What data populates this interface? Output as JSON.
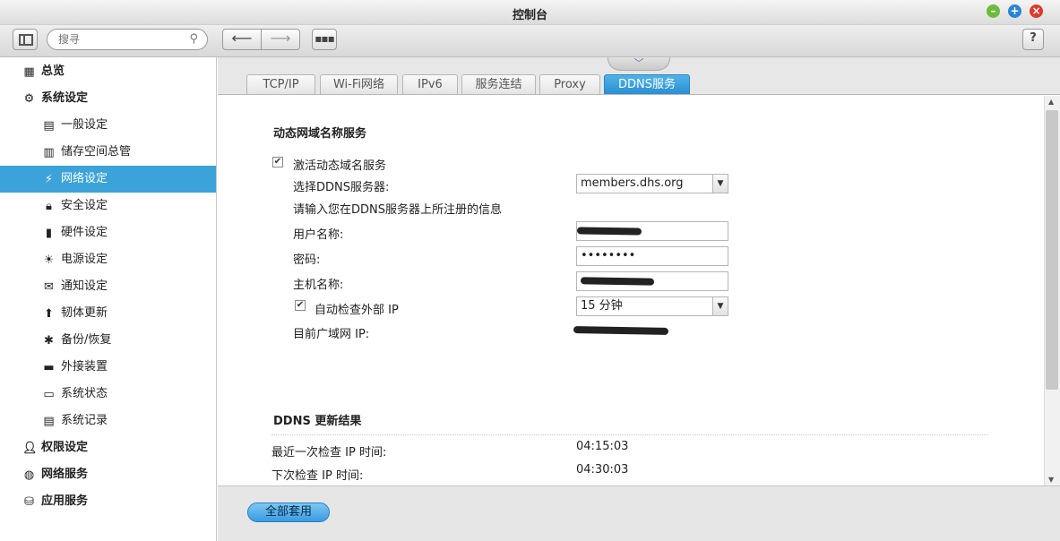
{
  "window": {
    "title": "控制台"
  },
  "toolbar": {
    "search_placeholder": "搜寻",
    "help_label": "?"
  },
  "sidebar": {
    "items": [
      {
        "label": "总览",
        "icon": "overview-icon",
        "level": "top"
      },
      {
        "label": "系统设定",
        "icon": "gear-icon",
        "level": "top"
      },
      {
        "label": "一般设定",
        "icon": "general-settings-icon",
        "level": "sub"
      },
      {
        "label": "储存空间总管",
        "icon": "storage-icon",
        "level": "sub"
      },
      {
        "label": "网络设定",
        "icon": "network-icon",
        "level": "sub",
        "active": true
      },
      {
        "label": "安全设定",
        "icon": "lock-icon",
        "level": "sub"
      },
      {
        "label": "硬件设定",
        "icon": "hardware-icon",
        "level": "sub"
      },
      {
        "label": "电源设定",
        "icon": "power-icon",
        "level": "sub"
      },
      {
        "label": "通知设定",
        "icon": "notification-icon",
        "level": "sub"
      },
      {
        "label": "韧体更新",
        "icon": "firmware-icon",
        "level": "sub"
      },
      {
        "label": "备份/恢复",
        "icon": "backup-icon",
        "level": "sub"
      },
      {
        "label": "外接装置",
        "icon": "external-device-icon",
        "level": "sub"
      },
      {
        "label": "系统状态",
        "icon": "monitor-icon",
        "level": "sub"
      },
      {
        "label": "系统记录",
        "icon": "log-icon",
        "level": "sub"
      },
      {
        "label": "权限设定",
        "icon": "user-icon",
        "level": "top"
      },
      {
        "label": "网络服务",
        "icon": "globe-icon",
        "level": "top"
      },
      {
        "label": "应用服务",
        "icon": "app-service-icon",
        "level": "top"
      }
    ]
  },
  "tabs": [
    {
      "label": "TCP/IP"
    },
    {
      "label": "Wi-Fi网络"
    },
    {
      "label": "IPv6"
    },
    {
      "label": "服务连结"
    },
    {
      "label": "Proxy"
    },
    {
      "label": "DDNS服务",
      "active": true
    }
  ],
  "ddns": {
    "section_title": "动态网域名称服务",
    "enable_label": "激活动态域名服务",
    "enable_checked": true,
    "server_label": "选择DDNS服务器:",
    "server_value": "members.dhs.org",
    "info_text": "请输入您在DDNS服务器上所注册的信息",
    "username_label": "用户名称:",
    "password_label": "密码:",
    "password_value": "••••••••",
    "hostname_label": "主机名称:",
    "auto_check_label": "自动检查外部 IP",
    "auto_check_checked": true,
    "interval_value": "15 分钟",
    "wan_ip_label": "目前广域网 IP:"
  },
  "result": {
    "section_title": "DDNS 更新结果",
    "last_check_label": "最近一次检查 IP 时间:",
    "last_check_value": "04:15:03",
    "next_check_label": "下次检查 IP 时间:",
    "next_check_value": "04:30:03"
  },
  "footer": {
    "apply_label": "全部套用"
  }
}
